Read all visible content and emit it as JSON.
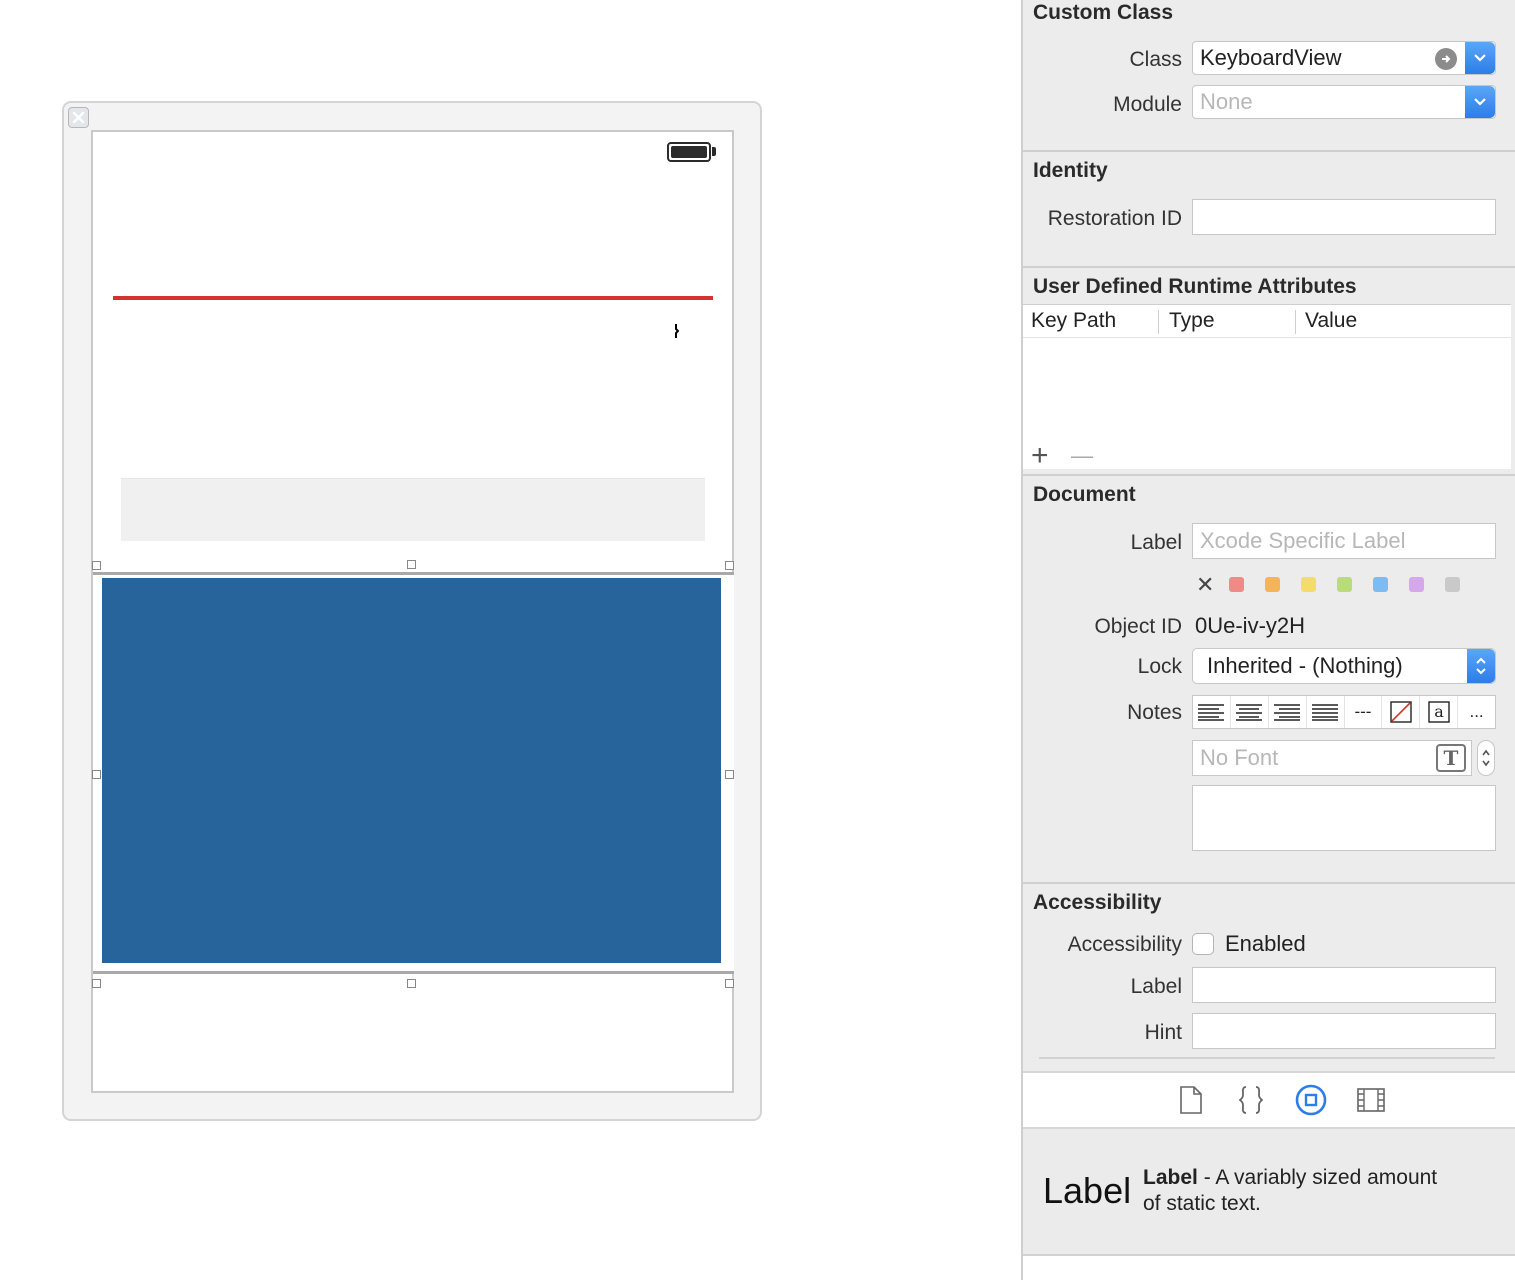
{
  "inspector": {
    "custom_class": {
      "title": "Custom Class",
      "class_label": "Class",
      "class_value": "KeyboardView",
      "module_label": "Module",
      "module_placeholder": "None"
    },
    "identity": {
      "title": "Identity",
      "restoration_label": "Restoration ID",
      "restoration_value": ""
    },
    "runtime_attributes": {
      "title": "User Defined Runtime Attributes",
      "columns": [
        "Key Path",
        "Type",
        "Value"
      ],
      "add": "+",
      "remove": "—"
    },
    "document": {
      "title": "Document",
      "label_label": "Label",
      "label_placeholder": "Xcode Specific Label",
      "clear_color": "✕",
      "label_colors": [
        "#f08a86",
        "#f4b45e",
        "#f4dc6a",
        "#b9dc7a",
        "#7cbcf2",
        "#d5a8ea",
        "#c9c9c9"
      ],
      "object_id_label": "Object ID",
      "object_id_value": "0Ue-iv-y2H",
      "lock_label": "Lock",
      "lock_value": "Inherited - (Nothing)",
      "notes_label": "Notes",
      "font_placeholder": "No Font",
      "notes_tools": [
        "align-left-icon",
        "align-center-icon",
        "align-right-icon",
        "align-justify-icon",
        "---",
        "no-color-icon",
        "text-color-icon",
        "..."
      ]
    },
    "accessibility": {
      "title": "Accessibility",
      "accessibility_label": "Accessibility",
      "enabled_label": "Enabled",
      "enabled": false,
      "label_label": "Label",
      "label_value": "",
      "hint_label": "Hint",
      "hint_value": ""
    },
    "tabs": [
      "file-icon",
      "braces-icon",
      "object-icon",
      "media-icon"
    ],
    "library": {
      "preview": "Label",
      "name": "Label",
      "description_1": " - A variably sized amount",
      "description_2": "of static text."
    }
  },
  "colors": {
    "accent": "#2c7de8",
    "view_blue": "#27649b",
    "red_line": "#d4322a"
  }
}
